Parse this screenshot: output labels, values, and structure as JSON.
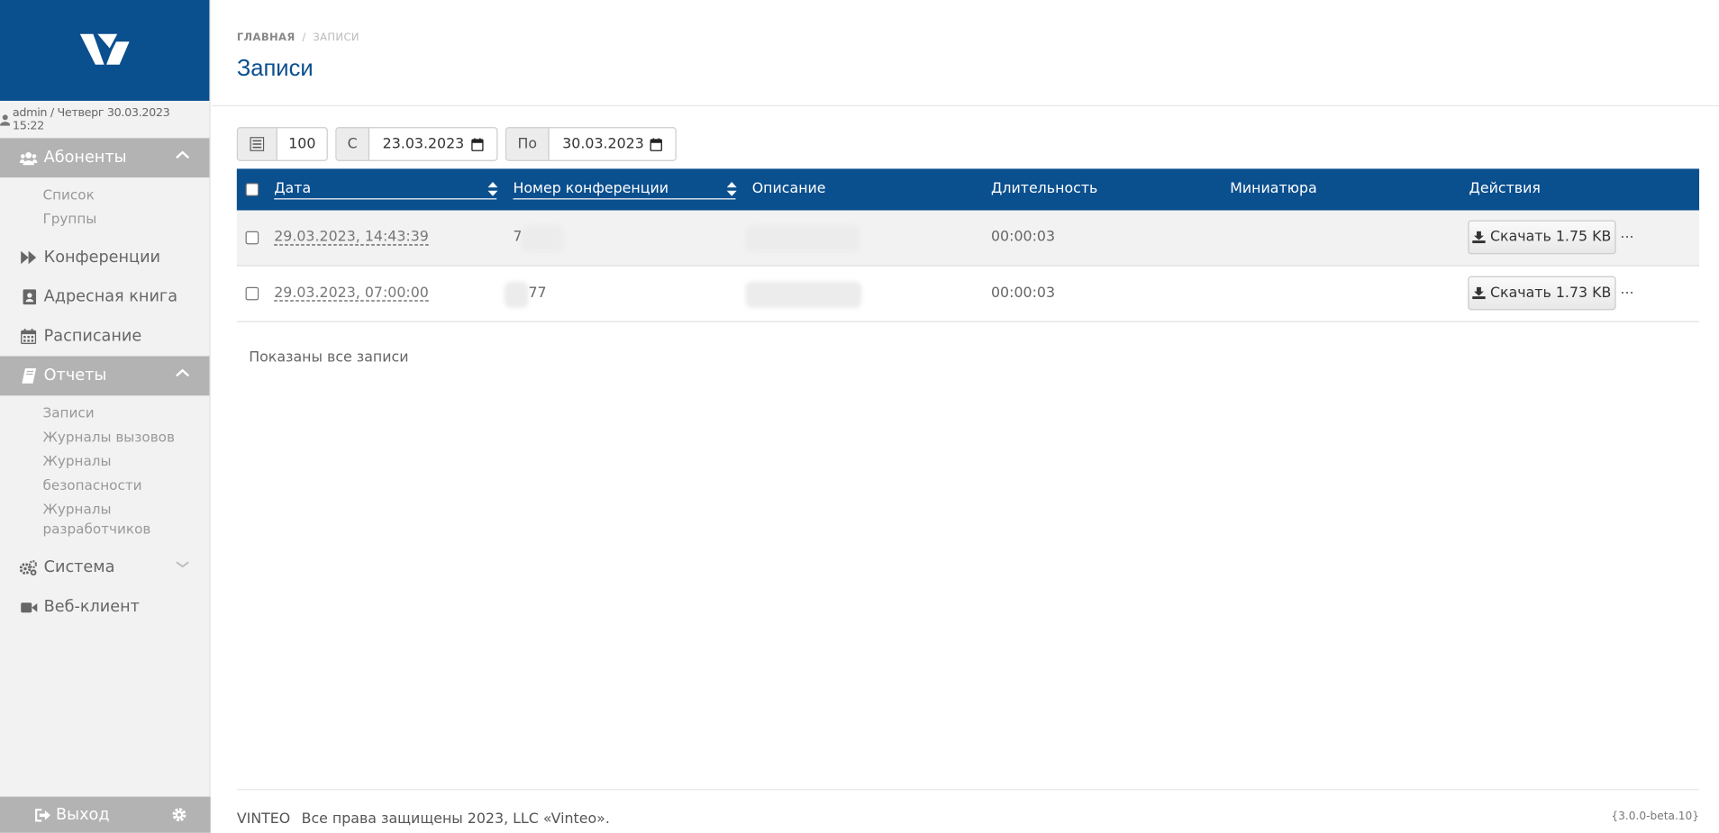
{
  "colors": {
    "brand": "#0a4f8e",
    "sidebar_active": "#b3b3b3",
    "sidebar_bg": "#f2f2f2"
  },
  "user": {
    "text": "admin / Четверг 30.03.2023 15:22"
  },
  "sidebar": {
    "sections": [
      {
        "label": "Абоненты",
        "icon": "users-icon",
        "expanded": true
      },
      {
        "label": "Конференции",
        "icon": "fast-forward-icon"
      },
      {
        "label": "Адресная книга",
        "icon": "address-book-icon"
      },
      {
        "label": "Расписание",
        "icon": "calendar-icon"
      },
      {
        "label": "Отчеты",
        "icon": "book-icon",
        "expanded": true
      },
      {
        "label": "Система",
        "icon": "gears-icon",
        "expanded": false
      },
      {
        "label": "Веб-клиент",
        "icon": "video-camera-icon"
      }
    ],
    "subscribers_items": [
      "Список",
      "Группы"
    ],
    "reports_items": [
      "Записи",
      "Журналы вызовов",
      "Журналы безопасности",
      "Журналы разработчиков"
    ],
    "logout_label": "Выход"
  },
  "breadcrumb": {
    "home": "ГЛАВНАЯ",
    "separator": "/",
    "current": "ЗАПИСИ"
  },
  "page_title": "Записи",
  "filters": {
    "page_size": "100",
    "from_label": "С",
    "from_date": "23.03.2023",
    "to_label": "По",
    "to_date": "30.03.2023"
  },
  "table": {
    "columns": [
      "Дата",
      "Номер конференции",
      "Описание",
      "Длительность",
      "Миниатюра",
      "Действия"
    ],
    "rows": [
      {
        "date": "29.03.2023, 14:43:39",
        "conf_number": "7",
        "duration": "00:00:03",
        "download": "Скачать 1.75 KB",
        "more": "..."
      },
      {
        "date": "29.03.2023, 07:00:00",
        "conf_number": "77",
        "duration": "00:00:03",
        "download": "Скачать 1.73 KB",
        "more": "..."
      }
    ],
    "summary": "Показаны все записи"
  },
  "footer": {
    "brand": "VINTEO",
    "copyright": "Все права защищены 2023, LLC «Vinteo».",
    "version": "{3.0.0-beta.10}"
  }
}
